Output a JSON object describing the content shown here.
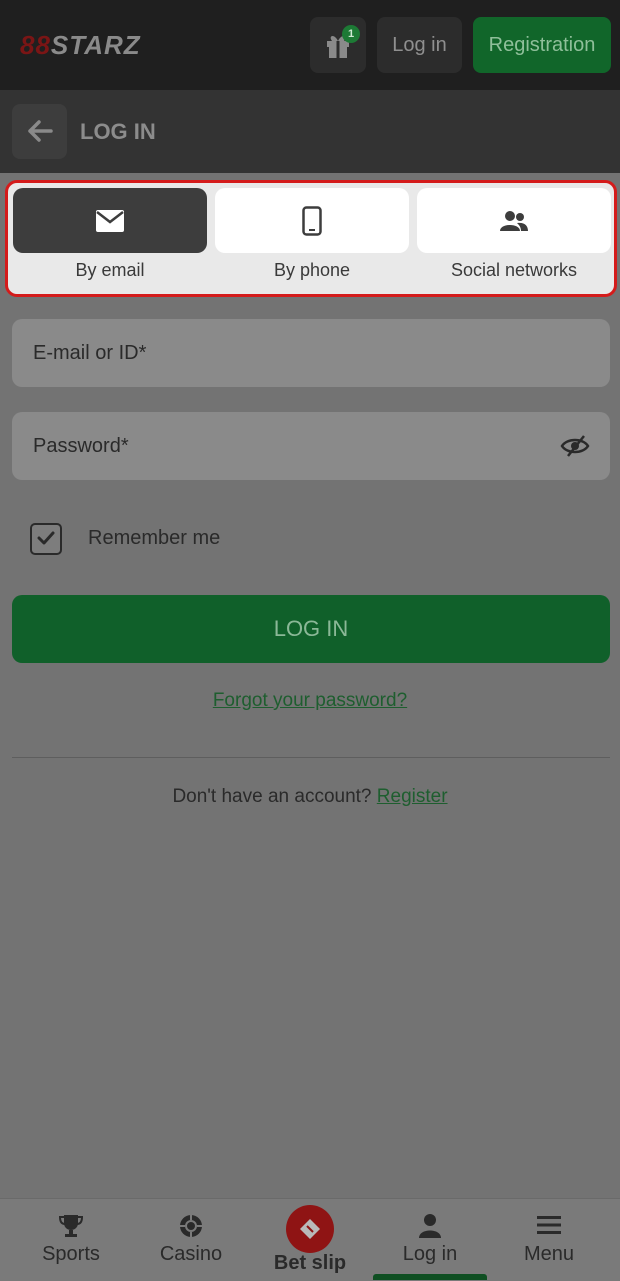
{
  "header": {
    "logo_text": "STARZ",
    "logo_mark": "88",
    "gift_badge": "1",
    "login_label": "Log in",
    "register_label": "Registration"
  },
  "subheader": {
    "title": "LOG IN"
  },
  "methods": [
    {
      "label": "By email",
      "icon": "envelope-icon",
      "active": true
    },
    {
      "label": "By phone",
      "icon": "phone-icon",
      "active": false
    },
    {
      "label": "Social networks",
      "icon": "people-icon",
      "active": false
    }
  ],
  "form": {
    "email_placeholder": "E-mail or ID*",
    "email_value": "",
    "password_placeholder": "Password*",
    "password_value": "",
    "remember_label": "Remember me",
    "remember_checked": true,
    "submit_label": "LOG IN",
    "forgot_label": "Forgot your password?",
    "no_account_text": "Don't have an account?",
    "register_link": "Register"
  },
  "bottom_nav": [
    {
      "label": "Sports",
      "icon": "trophy-icon"
    },
    {
      "label": "Casino",
      "icon": "chip-icon"
    },
    {
      "label": "Bet slip",
      "icon": "ticket-icon"
    },
    {
      "label": "Log in",
      "icon": "user-icon",
      "active": true
    },
    {
      "label": "Menu",
      "icon": "hamburger-icon"
    }
  ],
  "colors": {
    "brand_green": "#11662a",
    "highlight_red": "#d41b1b",
    "overlay_grey": "#737373"
  }
}
